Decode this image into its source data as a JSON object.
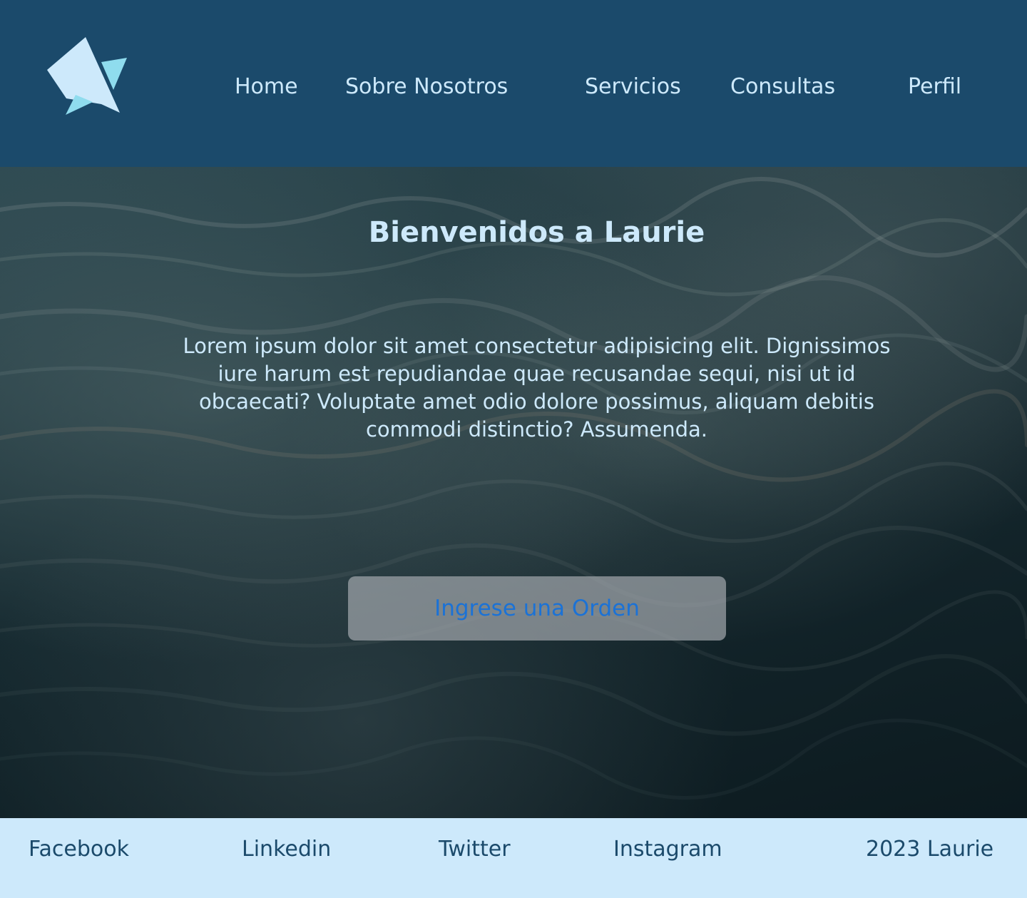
{
  "brand": {
    "logo_icon": "star-icon",
    "colors": {
      "primary": "#1b4a6b",
      "light": "#cde9fb",
      "accent": "#8fdcee",
      "button_text": "#1b72d6"
    }
  },
  "nav": {
    "items": [
      {
        "label": "Home"
      },
      {
        "label": "Sobre Nosotros"
      },
      {
        "label": "Servicios"
      },
      {
        "label": "Consultas"
      },
      {
        "label": "Perfil"
      }
    ]
  },
  "hero": {
    "background": "ocean-waves-image",
    "title": "Bienvenidos a Laurie",
    "body": "Lorem ipsum dolor sit amet consectetur adipisicing elit. Dignissimos iure harum est repudiandae quae recusandae sequi, nisi ut id obcaecati? Voluptate amet odio dolore possimus, aliquam debitis commodi distinctio? Assumenda.",
    "cta_label": "Ingrese una Orden"
  },
  "footer": {
    "links": [
      {
        "label": "Facebook"
      },
      {
        "label": "Linkedin"
      },
      {
        "label": "Twitter"
      },
      {
        "label": "Instagram"
      }
    ],
    "copyright": "2023 Laurie"
  }
}
